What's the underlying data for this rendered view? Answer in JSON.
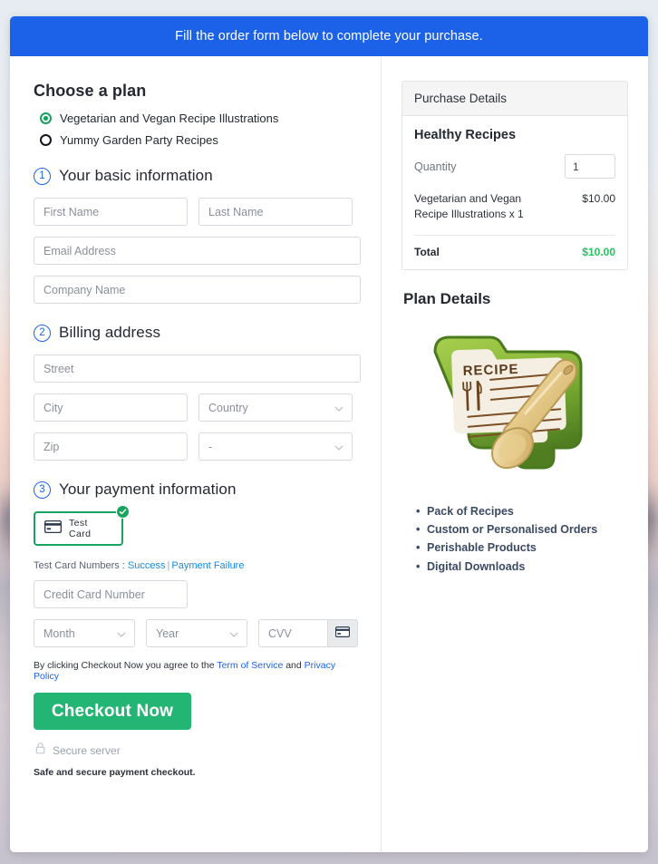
{
  "banner": {
    "text": "Fill the order form below to complete your purchase."
  },
  "plans": {
    "heading": "Choose a plan",
    "options": [
      {
        "label": "Vegetarian and Vegan Recipe Illustrations",
        "selected": true
      },
      {
        "label": "Yummy Garden Party Recipes",
        "selected": false
      }
    ]
  },
  "steps": {
    "basic": {
      "num": "1",
      "label": "Your basic information"
    },
    "billing": {
      "num": "2",
      "label": "Billing address"
    },
    "payment": {
      "num": "3",
      "label": "Your payment information"
    }
  },
  "fields": {
    "first_name": "First Name",
    "last_name": "Last Name",
    "email": "Email Address",
    "company": "Company Name",
    "street": "Street",
    "city": "City",
    "country": "Country",
    "zip": "Zip",
    "state": "-",
    "credit_card": "Credit Card Number",
    "month": "Month",
    "year": "Year",
    "cvv": "CVV"
  },
  "payment": {
    "method_label": "Test Card",
    "method_selected": true,
    "test_cards_prefix": "Test Card Numbers :",
    "success_link": "Success",
    "separator": "|",
    "failure_link": "Payment Failure"
  },
  "terms": {
    "prefix": "By clicking Checkout Now you agree to the",
    "tos": "Term of Service",
    "and": "and",
    "privacy": "Privacy Policy"
  },
  "checkout": {
    "button": "Checkout Now",
    "secure_server": "Secure server",
    "safe_note": "Safe and secure payment checkout."
  },
  "purchase": {
    "panel_heading": "Purchase Details",
    "product_title": "Healthy Recipes",
    "quantity_label": "Quantity",
    "quantity_value": "1",
    "item_desc": "Vegetarian and Vegan Recipe Illustrations x 1",
    "item_amount": "$10.00",
    "total_label": "Total",
    "total_amount": "$10.00"
  },
  "plan_details": {
    "heading": "Plan Details",
    "art_label": "RECIPE",
    "features": [
      "Pack of Recipes",
      "Custom or Personalised Orders",
      "Perishable Products",
      "Digital Downloads"
    ]
  },
  "colors": {
    "banner_blue": "#1b62e8",
    "accent_green": "#22b573",
    "total_green": "#22c55e",
    "link_blue": "#1b8ae0"
  }
}
